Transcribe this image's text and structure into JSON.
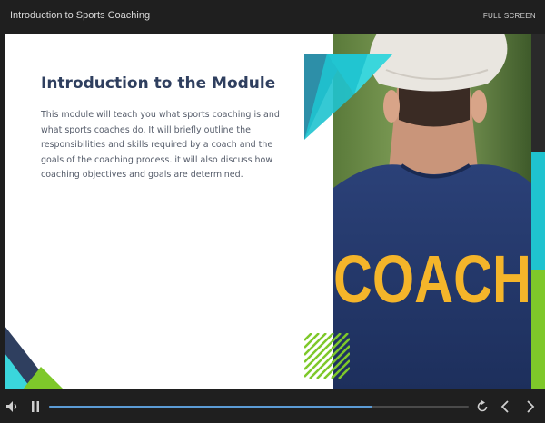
{
  "window": {
    "title": "Introduction to Sports Coaching",
    "fullscreen_label": "FULL SCREEN"
  },
  "slide": {
    "heading": "Introduction to the Module",
    "body": "This module will teach you what sports coaching is and what sports coaches do. It will briefly outline the responsibilities and skills required by a coach and the goals of the coaching process. it will also discuss how coaching objectives and goals are determined.",
    "image_text": "COACH"
  },
  "player": {
    "progress_percent": 77
  },
  "colors": {
    "topbar": "#1f1f1f",
    "heading": "#2f3f5f",
    "body_text": "#555c6a",
    "accent_teal": "#1fc3cf",
    "accent_navy": "#2f3f5f",
    "accent_green": "#7ec82a",
    "shirt_navy": "#24386c",
    "progress": "#5b9bd5"
  },
  "icons": [
    "volume-icon",
    "pause-icon",
    "replay-icon",
    "previous-icon",
    "next-icon"
  ]
}
